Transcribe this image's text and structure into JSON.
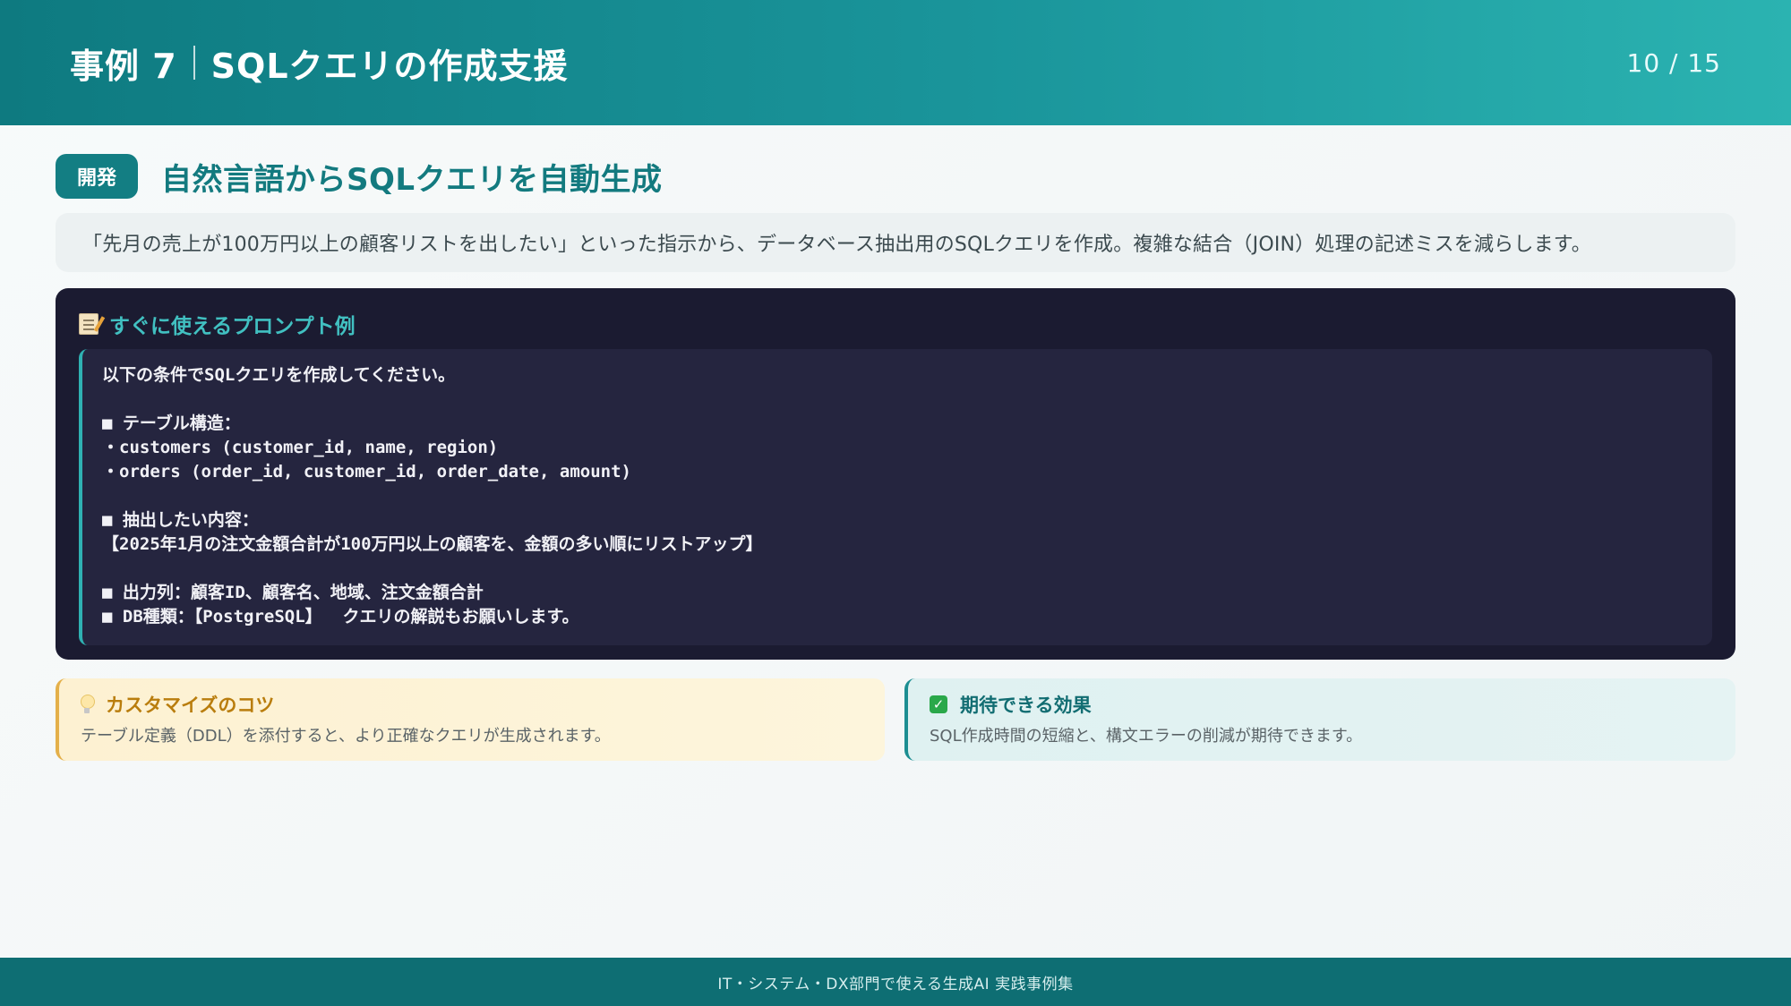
{
  "header": {
    "case_label": "事例 7",
    "title": "SQLクエリの作成支援",
    "page_indicator": "10 / 15"
  },
  "section": {
    "badge": "開発",
    "subtitle": "自然言語からSQLクエリを自動生成",
    "description": "「先月の売上が100万円以上の顧客リストを出したい」といった指示から、データベース抽出用のSQLクエリを作成。複雑な結合（JOIN）処理の記述ミスを減らします。"
  },
  "prompt": {
    "heading": "すぐに使えるプロンプト例",
    "icon": "memo-icon",
    "text": "以下の条件でSQLクエリを作成してください。\n\n■ テーブル構造：\n・customers (customer_id, name, region)\n・orders (order_id, customer_id, order_date, amount)\n\n■ 抽出したい内容：\n【2025年1月の注文金額合計が100万円以上の顧客を、金額の多い順にリストアップ】\n\n■ 出力列：顧客ID、顧客名、地域、注文金額合計\n■ DB種類：【PostgreSQL】  クエリの解説もお願いします。"
  },
  "tips": {
    "icon": "lightbulb-icon",
    "heading": "カスタマイズのコツ",
    "body": "テーブル定義（DDL）を添付すると、より正確なクエリが生成されます。"
  },
  "effect": {
    "icon": "check-icon",
    "heading": "期待できる効果",
    "body": "SQL作成時間の短縮と、構文エラーの削減が期待できます。"
  },
  "footer": {
    "text": "IT・システム・DX部門で使える生成AI 実践事例集"
  },
  "colors": {
    "header_start": "#0e7a80",
    "header_end": "#2bb3b1",
    "accent_teal": "#137e83",
    "prompt_bg": "#1b1b31",
    "tips_accent": "#e4b04a",
    "footer_bg": "#0e6e73"
  }
}
